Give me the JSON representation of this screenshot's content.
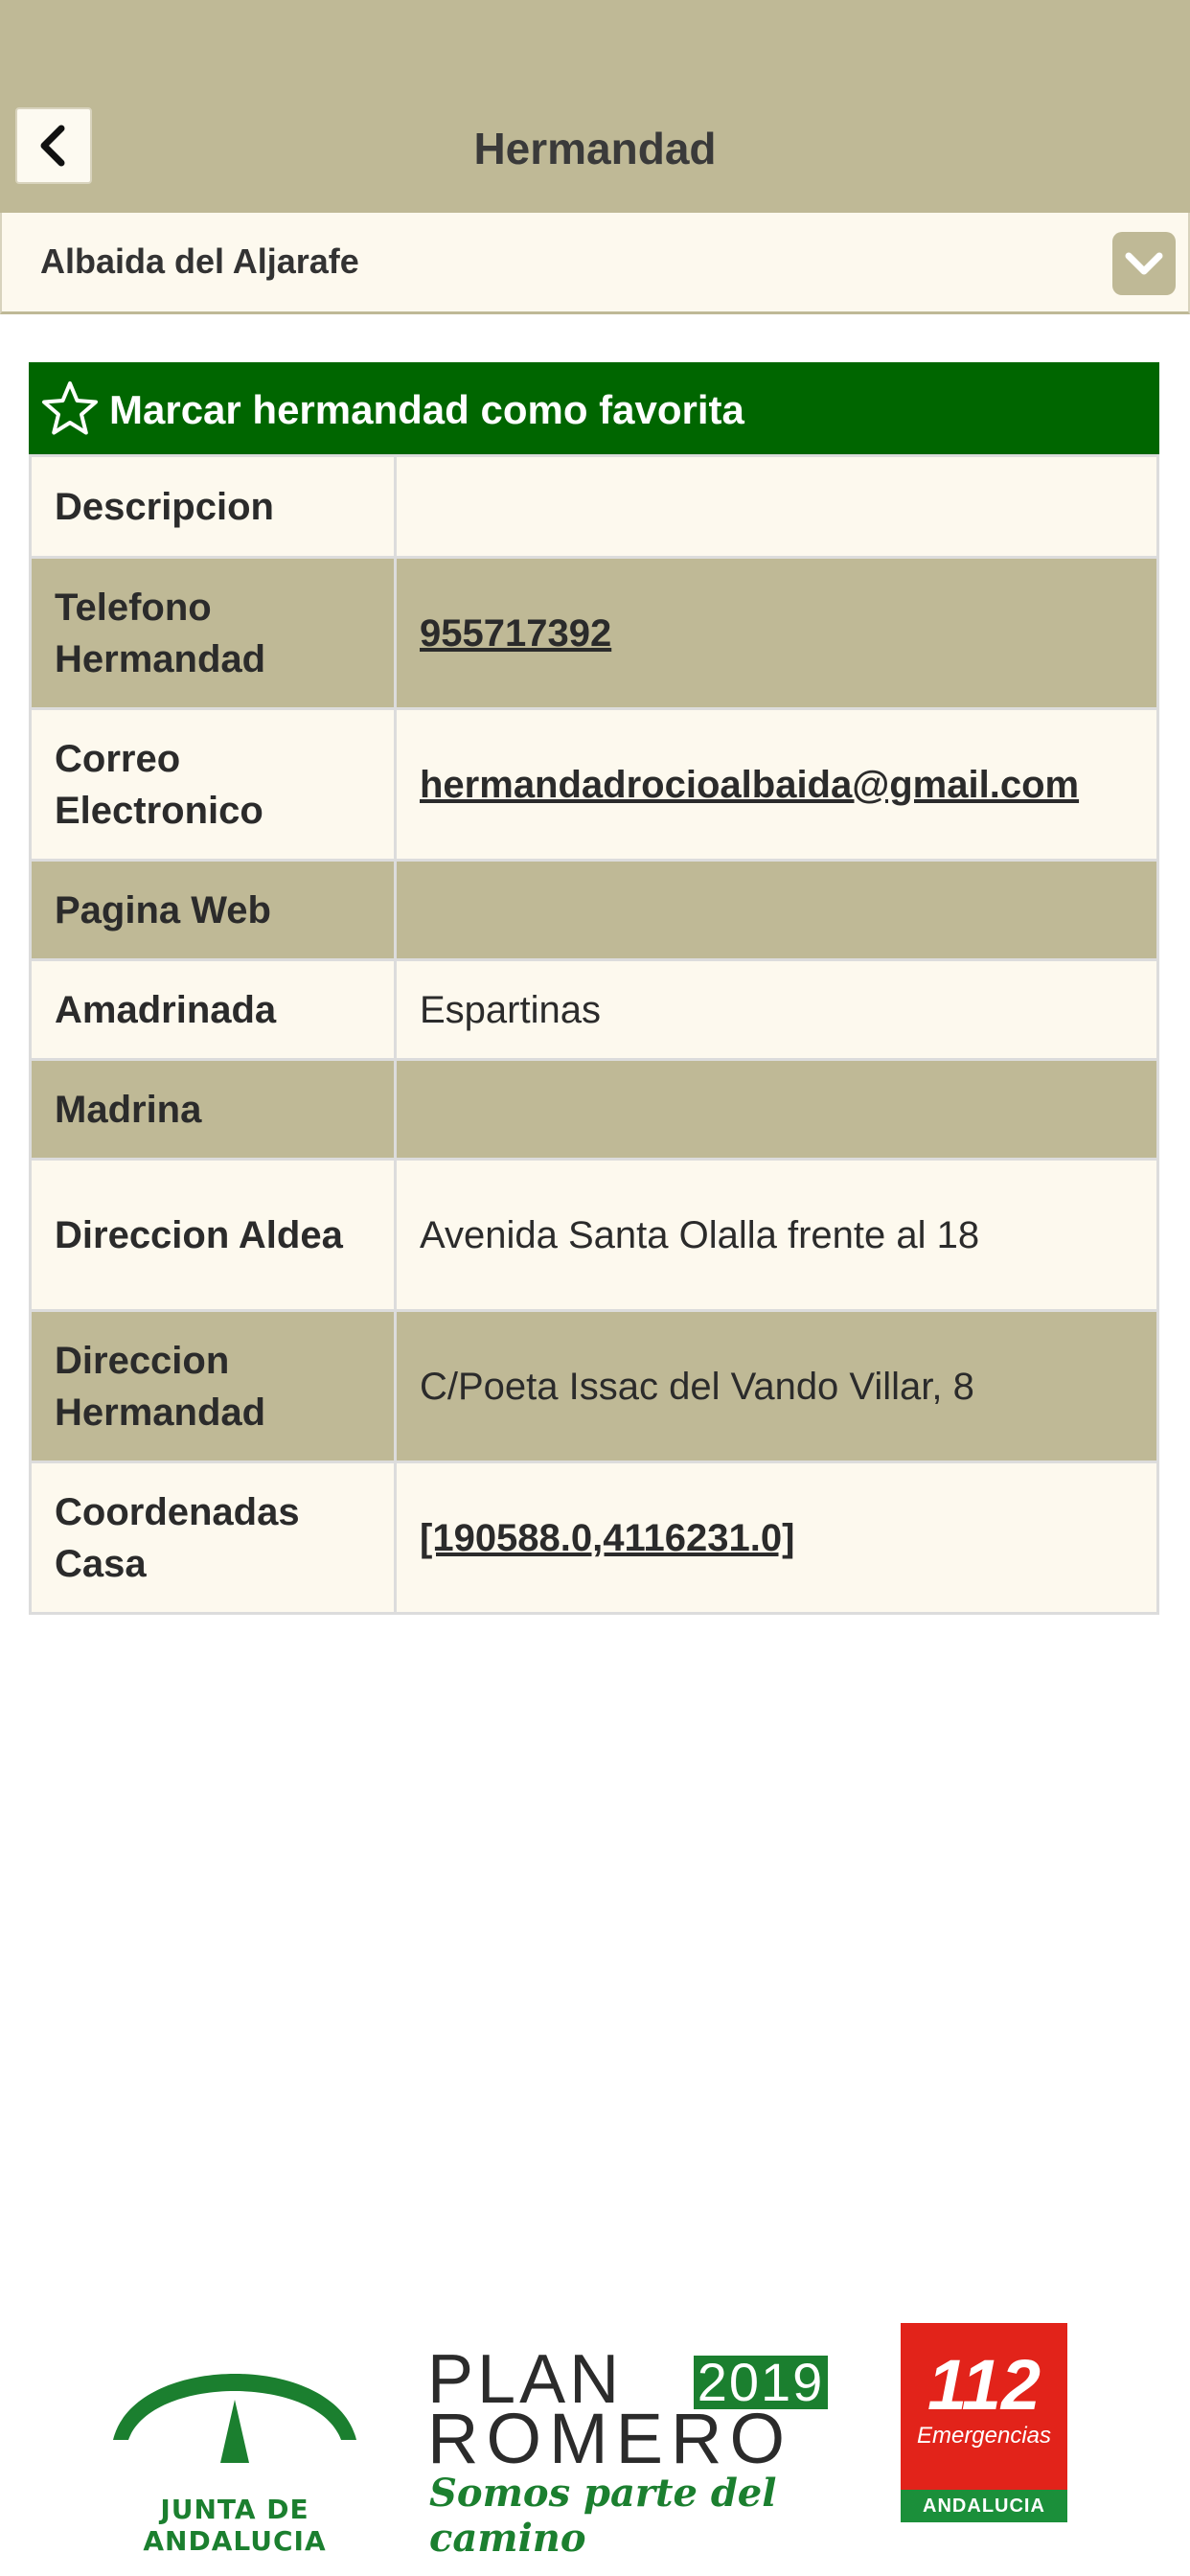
{
  "header": {
    "title": "Hermandad",
    "back_icon": "chevron-left-icon"
  },
  "selector": {
    "value": "Albaida del Aljarafe",
    "chevron_icon": "chevron-down-icon"
  },
  "favorite": {
    "label": "Marcar hermandad como favorita",
    "icon": "star-outline-icon"
  },
  "rows": [
    {
      "label": "Descripcion",
      "value": ""
    },
    {
      "label": "Telefono Hermandad",
      "value": "955717392",
      "link": true
    },
    {
      "label": "Correo Electronico",
      "value": "hermandadrocioalbaida@gmail.com",
      "link": true
    },
    {
      "label": "Pagina Web",
      "value": ""
    },
    {
      "label": "Amadrinada",
      "value": "Espartinas"
    },
    {
      "label": "Madrina",
      "value": ""
    },
    {
      "label": "Direccion Aldea",
      "value": "Avenida Santa Olalla frente al 18"
    },
    {
      "label": "Direccion Hermandad",
      "value": "C/Poeta Issac del Vando Villar, 8"
    },
    {
      "label": "Coordenadas Casa",
      "value": "[190588.0,4116231.0]",
      "link": true
    }
  ],
  "footer": {
    "junta": "JUNTA DE ANDALUCIA",
    "plan": "PLAN",
    "year": "2019",
    "romero": "ROMERO",
    "tagline": "Somos parte del camino",
    "emergency_number": "112",
    "emergency_label": "Emergencias",
    "emergency_region": "ANDALUCIA"
  },
  "colors": {
    "header_bg": "#bfb996",
    "row_light": "#fdf9ee",
    "row_dark": "#bfb996",
    "favorite_bg": "#006600",
    "brand_green": "#1b7f2f",
    "emergency_red": "#e2231a"
  }
}
